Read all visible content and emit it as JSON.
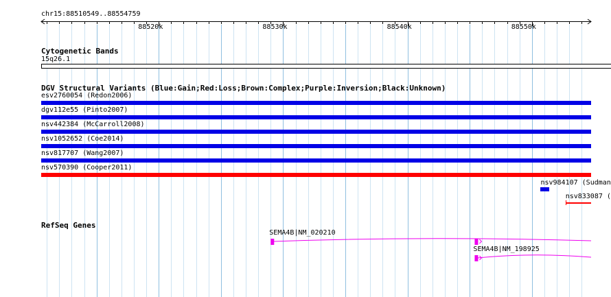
{
  "region": {
    "label": "chr15:88510549..88554759",
    "start": 88510549,
    "end": 88554759
  },
  "ruler": {
    "ticks": [
      {
        "pos": 88520000,
        "label": "88520k"
      },
      {
        "pos": 88530000,
        "label": "88530k"
      },
      {
        "pos": 88540000,
        "label": "88540k"
      },
      {
        "pos": 88550000,
        "label": "88550k"
      }
    ]
  },
  "cytoband": {
    "title": "Cytogenetic Bands",
    "band": "15q26.1"
  },
  "dgv": {
    "title": "DGV Structural Variants (Blue:Gain;Red:Loss;Brown:Complex;Purple:Inversion;Black:Unknown)",
    "variants": [
      {
        "label": "esv2760054 (Redon2006)",
        "start": 88510549,
        "end": 88554759,
        "color": "#0000e6"
      },
      {
        "label": "dgv112e55 (Pinto2007)",
        "start": 88510549,
        "end": 88554759,
        "color": "#0000e6"
      },
      {
        "label": "nsv442384 (McCarroll2008)",
        "start": 88510549,
        "end": 88554759,
        "color": "#0000e6"
      },
      {
        "label": "nsv1052652 (Coe2014)",
        "start": 88510549,
        "end": 88554759,
        "color": "#0000e6"
      },
      {
        "label": "nsv817707 (Wang2007)",
        "start": 88510549,
        "end": 88554759,
        "color": "#0000e6"
      },
      {
        "label": "nsv570390 (Cooper2011)",
        "start": 88510549,
        "end": 88554759,
        "color": "#ff0000"
      },
      {
        "label": "nsv984107 (Sudman",
        "start": 88550700,
        "end": 88551400,
        "color": "#0000e6"
      },
      {
        "label": "nsv833087 (",
        "start": 88552700,
        "end": 88554759,
        "color": "#ff0000"
      }
    ]
  },
  "refseq": {
    "title": "RefSeq Genes",
    "genes": [
      {
        "label": "SEMA4B|NM_020210",
        "start": 88529000,
        "end": 88554759,
        "color": "#ee00ee"
      },
      {
        "label": "SEMA4B|NM_198925",
        "start": 88545400,
        "end": 88554759,
        "color": "#ee00ee"
      }
    ]
  },
  "colors": {
    "grid_major": "#8fbfe0",
    "grid_minor": "#cde3f2",
    "axis": "#000000"
  }
}
